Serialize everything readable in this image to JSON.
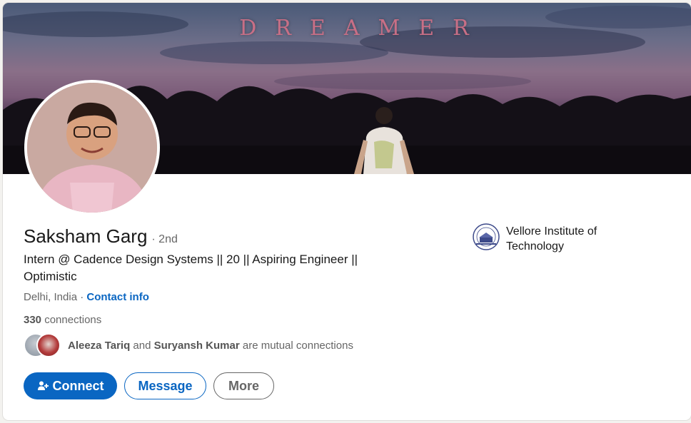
{
  "banner": {
    "title": "DREAMER",
    "colors": {
      "sky_top": "#4a5a78",
      "sky_mid": "#8a6f88",
      "ground": "#1d1622",
      "title": "#c86f86"
    }
  },
  "profile": {
    "name": "Saksham Garg",
    "degree": "· 2nd",
    "headline": "Intern @ Cadence Design Systems || 20 || Aspiring Engineer || Optimistic",
    "location": "Delhi, India",
    "separator": " · ",
    "contact_info": "Contact info",
    "connections_count": "330",
    "connections_label": " connections"
  },
  "mutual": {
    "first": "Aleeza Tariq",
    "joiner": " and ",
    "second": "Suryansh Kumar",
    "suffix": " are mutual connections"
  },
  "actions": {
    "connect": "Connect",
    "message": "Message",
    "more": "More"
  },
  "education": {
    "school": "Vellore Institute of Technology",
    "logo_icon": "vit-logo-icon"
  },
  "colors": {
    "accent": "#0a66c2",
    "text_primary": "#191919",
    "text_secondary": "#666666"
  }
}
